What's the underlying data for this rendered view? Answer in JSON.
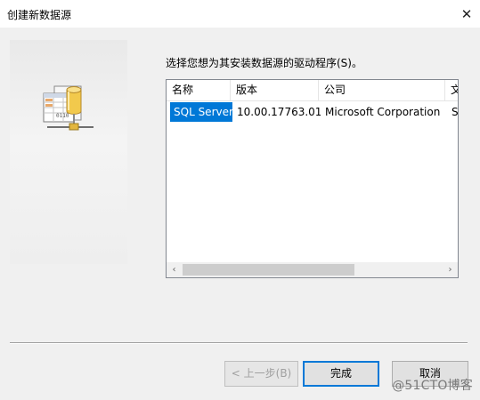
{
  "window": {
    "title": "创建新数据源",
    "close_glyph": "✕"
  },
  "prompt": "选择您想为其安装数据源的驱动程序(S)。",
  "driver_list": {
    "columns": [
      "名称",
      "版本",
      "公司",
      "文"
    ],
    "rows": [
      {
        "name": "SQL Server",
        "version": "10.00.17763.01",
        "company": "Microsoft Corporation",
        "extra": "S",
        "selected": true
      }
    ]
  },
  "scrollbar": {
    "left_glyph": "‹",
    "right_glyph": "›"
  },
  "buttons": {
    "back": "< 上一步(B)",
    "finish": "完成",
    "cancel": "取消"
  },
  "watermark": "@51CTO博客",
  "colors": {
    "selection": "#0078d7",
    "default_button_border": "#0078d7"
  }
}
